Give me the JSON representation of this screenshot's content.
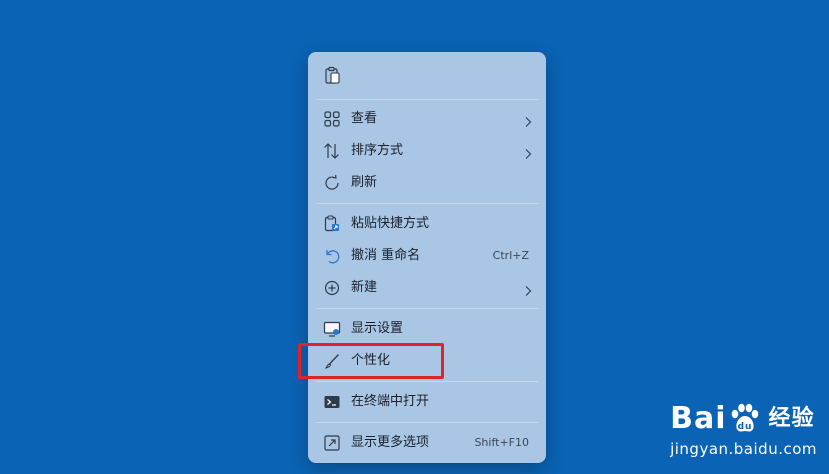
{
  "desktop": {
    "background_color": "#0a63b4"
  },
  "context_menu": {
    "top_action": {
      "icon": "clipboard-icon"
    },
    "items": [
      {
        "label": "查看",
        "icon": "grid-icon",
        "submenu": true
      },
      {
        "label": "排序方式",
        "icon": "sort-arrows-icon",
        "submenu": true
      },
      {
        "label": "刷新",
        "icon": "refresh-icon",
        "submenu": false
      },
      {
        "label": "粘贴快捷方式",
        "icon": "paste-shortcut-icon",
        "submenu": false
      },
      {
        "label": "撤消 重命名",
        "icon": "undo-icon",
        "shortcut": "Ctrl+Z"
      },
      {
        "label": "新建",
        "icon": "plus-circle-icon",
        "submenu": true
      },
      {
        "label": "显示设置",
        "icon": "display-settings-icon",
        "submenu": false
      },
      {
        "label": "个性化",
        "icon": "paintbrush-icon",
        "submenu": false
      },
      {
        "label": "在终端中打开",
        "icon": "terminal-icon",
        "submenu": false
      },
      {
        "label": "显示更多选项",
        "icon": "more-options-icon",
        "shortcut": "Shift+F10"
      }
    ]
  },
  "highlight": {
    "target": "个性化",
    "color": "#e0232a"
  },
  "watermark": {
    "brand": "Bai",
    "brand_tail": "经验",
    "url": "jingyan.baidu.com"
  }
}
